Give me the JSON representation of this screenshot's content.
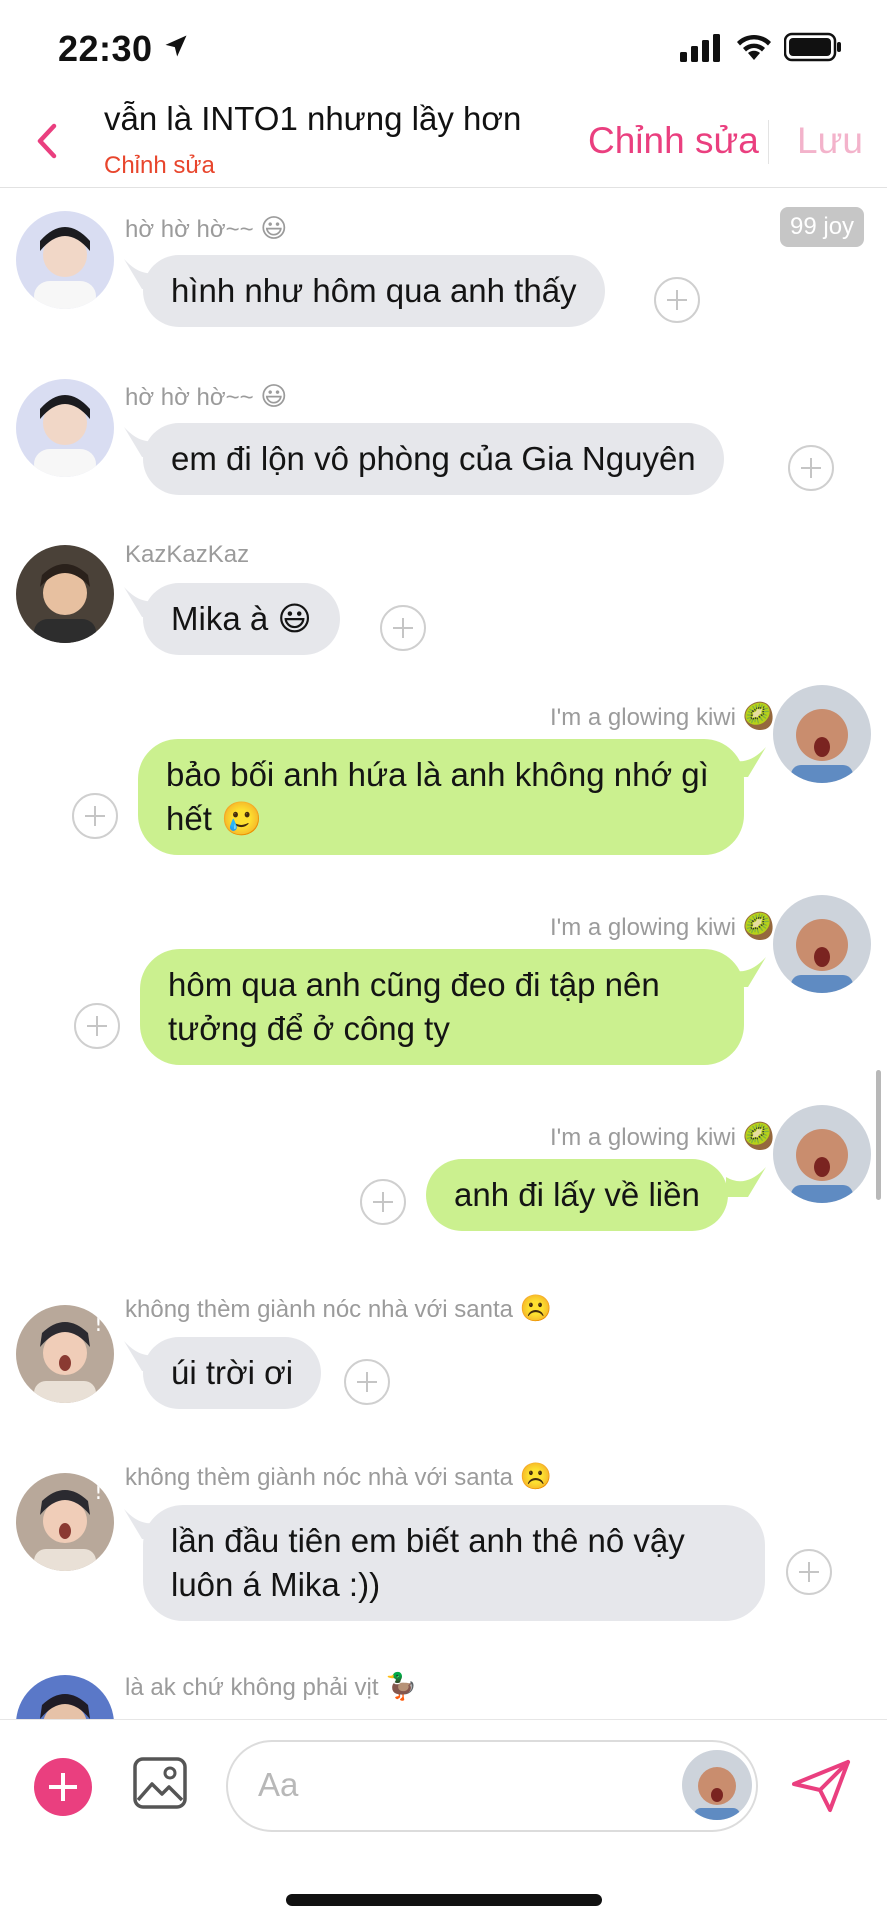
{
  "status_bar": {
    "time": "22:30",
    "location_icon": "location-arrow-icon",
    "signal_icon": "cellular-signal-icon",
    "wifi_icon": "wifi-icon",
    "battery_icon": "battery-icon"
  },
  "header": {
    "title": "vẫn là INTO1 nhưng lầy hơn",
    "subtitle": "Chỉnh sửa",
    "edit_label": "Chỉnh sửa",
    "save_label": "Lưu",
    "accent_color": "#ea3f7f"
  },
  "reaction_badge": "99 joy",
  "messages": [
    {
      "sender": "hờ hờ hờ~~",
      "sender_emoji": "😃",
      "text": "hình như hôm qua anh thấy",
      "direction": "in"
    },
    {
      "sender": "hờ hờ hờ~~",
      "sender_emoji": "😃",
      "text": "em đi lộn vô phòng của Gia Nguyên",
      "direction": "in"
    },
    {
      "sender": "KazKazKaz",
      "sender_emoji": "",
      "text": "Mika à 😃",
      "direction": "in"
    },
    {
      "sender": "I'm a glowing kiwi",
      "sender_emoji": "🥝",
      "text": "bảo bối anh hứa là anh không nhớ gì hết 🥲",
      "direction": "out"
    },
    {
      "sender": "I'm a glowing kiwi",
      "sender_emoji": "🥝",
      "text": "hôm qua anh cũng đeo đi tập nên tưởng để ở công ty",
      "direction": "out"
    },
    {
      "sender": "I'm a glowing kiwi",
      "sender_emoji": "🥝",
      "text": "anh đi lấy về liền",
      "direction": "out"
    },
    {
      "sender": "không thèm giành nóc nhà với santa",
      "sender_emoji": "☹️",
      "text": "úi trời ơi",
      "direction": "in"
    },
    {
      "sender": "không thèm giành nóc nhà với santa",
      "sender_emoji": "☹️",
      "text": "lần đầu tiên em biết anh thê nô vậy luôn á Mika :))",
      "direction": "in"
    },
    {
      "sender": "là ak chứ không phải vịt",
      "sender_emoji": "🦆",
      "text": "",
      "direction": "in"
    }
  ],
  "composer": {
    "placeholder": "Aa",
    "add_icon": "plus-icon",
    "image_icon": "image-icon",
    "send_icon": "send-icon"
  },
  "colors": {
    "incoming_bubble": "#e6e7eb",
    "outgoing_bubble": "#cbf08f",
    "accent": "#ea3f7f",
    "subtitle_red": "#e8452c"
  }
}
